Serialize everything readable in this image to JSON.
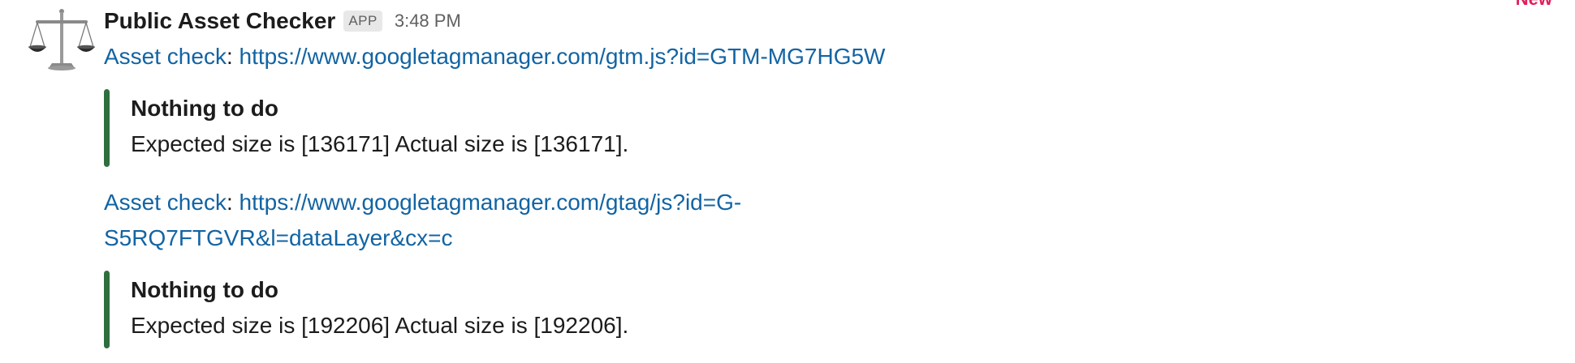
{
  "message": {
    "sender": "Public Asset Checker",
    "badge": "APP",
    "time": "3:48 PM",
    "new_marker": "New",
    "accent_color": "#2f6f3f",
    "link_color": "#1264a3",
    "checks": [
      {
        "label": "Asset check",
        "url": "https://www.googletagmanager.com/gtm.js?id=GTM-MG7HG5W",
        "url_lines": [
          "https://www.googletagmanager.com/gtm.js?id=GTM-MG7HG5W"
        ],
        "result_title": "Nothing to do",
        "result_text": "Expected size is [136171] Actual size is [136171]."
      },
      {
        "label": "Asset check",
        "url": "https://www.googletagmanager.com/gtag/js?id=G-S5RQ7FTGVR&l=dataLayer&cx=c",
        "url_lines": [
          "https://www.googletagmanager.com/gtag/js?id=G-",
          "S5RQ7FTGVR&l=dataLayer&cx=c"
        ],
        "result_title": "Nothing to do",
        "result_text": "Expected size is [192206] Actual size is [192206]."
      }
    ]
  }
}
